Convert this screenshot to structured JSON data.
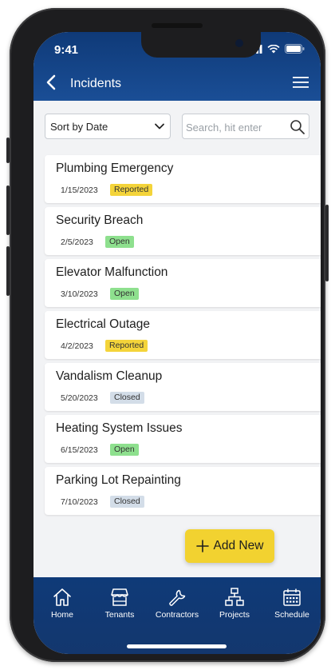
{
  "status_bar": {
    "time": "9:41"
  },
  "header": {
    "title": "Incidents"
  },
  "controls": {
    "sort_label": "Sort by Date",
    "search_placeholder": "Search, hit enter"
  },
  "incidents": [
    {
      "title": "Plumbing Emergency",
      "date": "1/15/2023",
      "status": "Reported"
    },
    {
      "title": "Security Breach",
      "date": "2/5/2023",
      "status": "Open"
    },
    {
      "title": "Elevator Malfunction",
      "date": "3/10/2023",
      "status": "Open"
    },
    {
      "title": "Electrical Outage",
      "date": "4/2/2023",
      "status": "Reported"
    },
    {
      "title": "Vandalism Cleanup",
      "date": "5/20/2023",
      "status": "Closed"
    },
    {
      "title": "Heating System Issues",
      "date": "6/15/2023",
      "status": "Open"
    },
    {
      "title": "Parking Lot Repainting",
      "date": "7/10/2023",
      "status": "Closed"
    }
  ],
  "status_colors": {
    "Reported": "#f4d43a",
    "Open": "#8ee08e",
    "Closed": "#d3dde8"
  },
  "fab": {
    "label": "Add New"
  },
  "tabs": [
    {
      "label": "Home",
      "icon": "home-icon"
    },
    {
      "label": "Tenants",
      "icon": "storefront-icon"
    },
    {
      "label": "Contractors",
      "icon": "wrench-icon"
    },
    {
      "label": "Projects",
      "icon": "hierarchy-icon"
    },
    {
      "label": "Schedule",
      "icon": "calendar-icon"
    }
  ],
  "colors": {
    "header_bg": "#0f3a78",
    "accent": "#f2d230",
    "background": "#f2f3f5"
  }
}
